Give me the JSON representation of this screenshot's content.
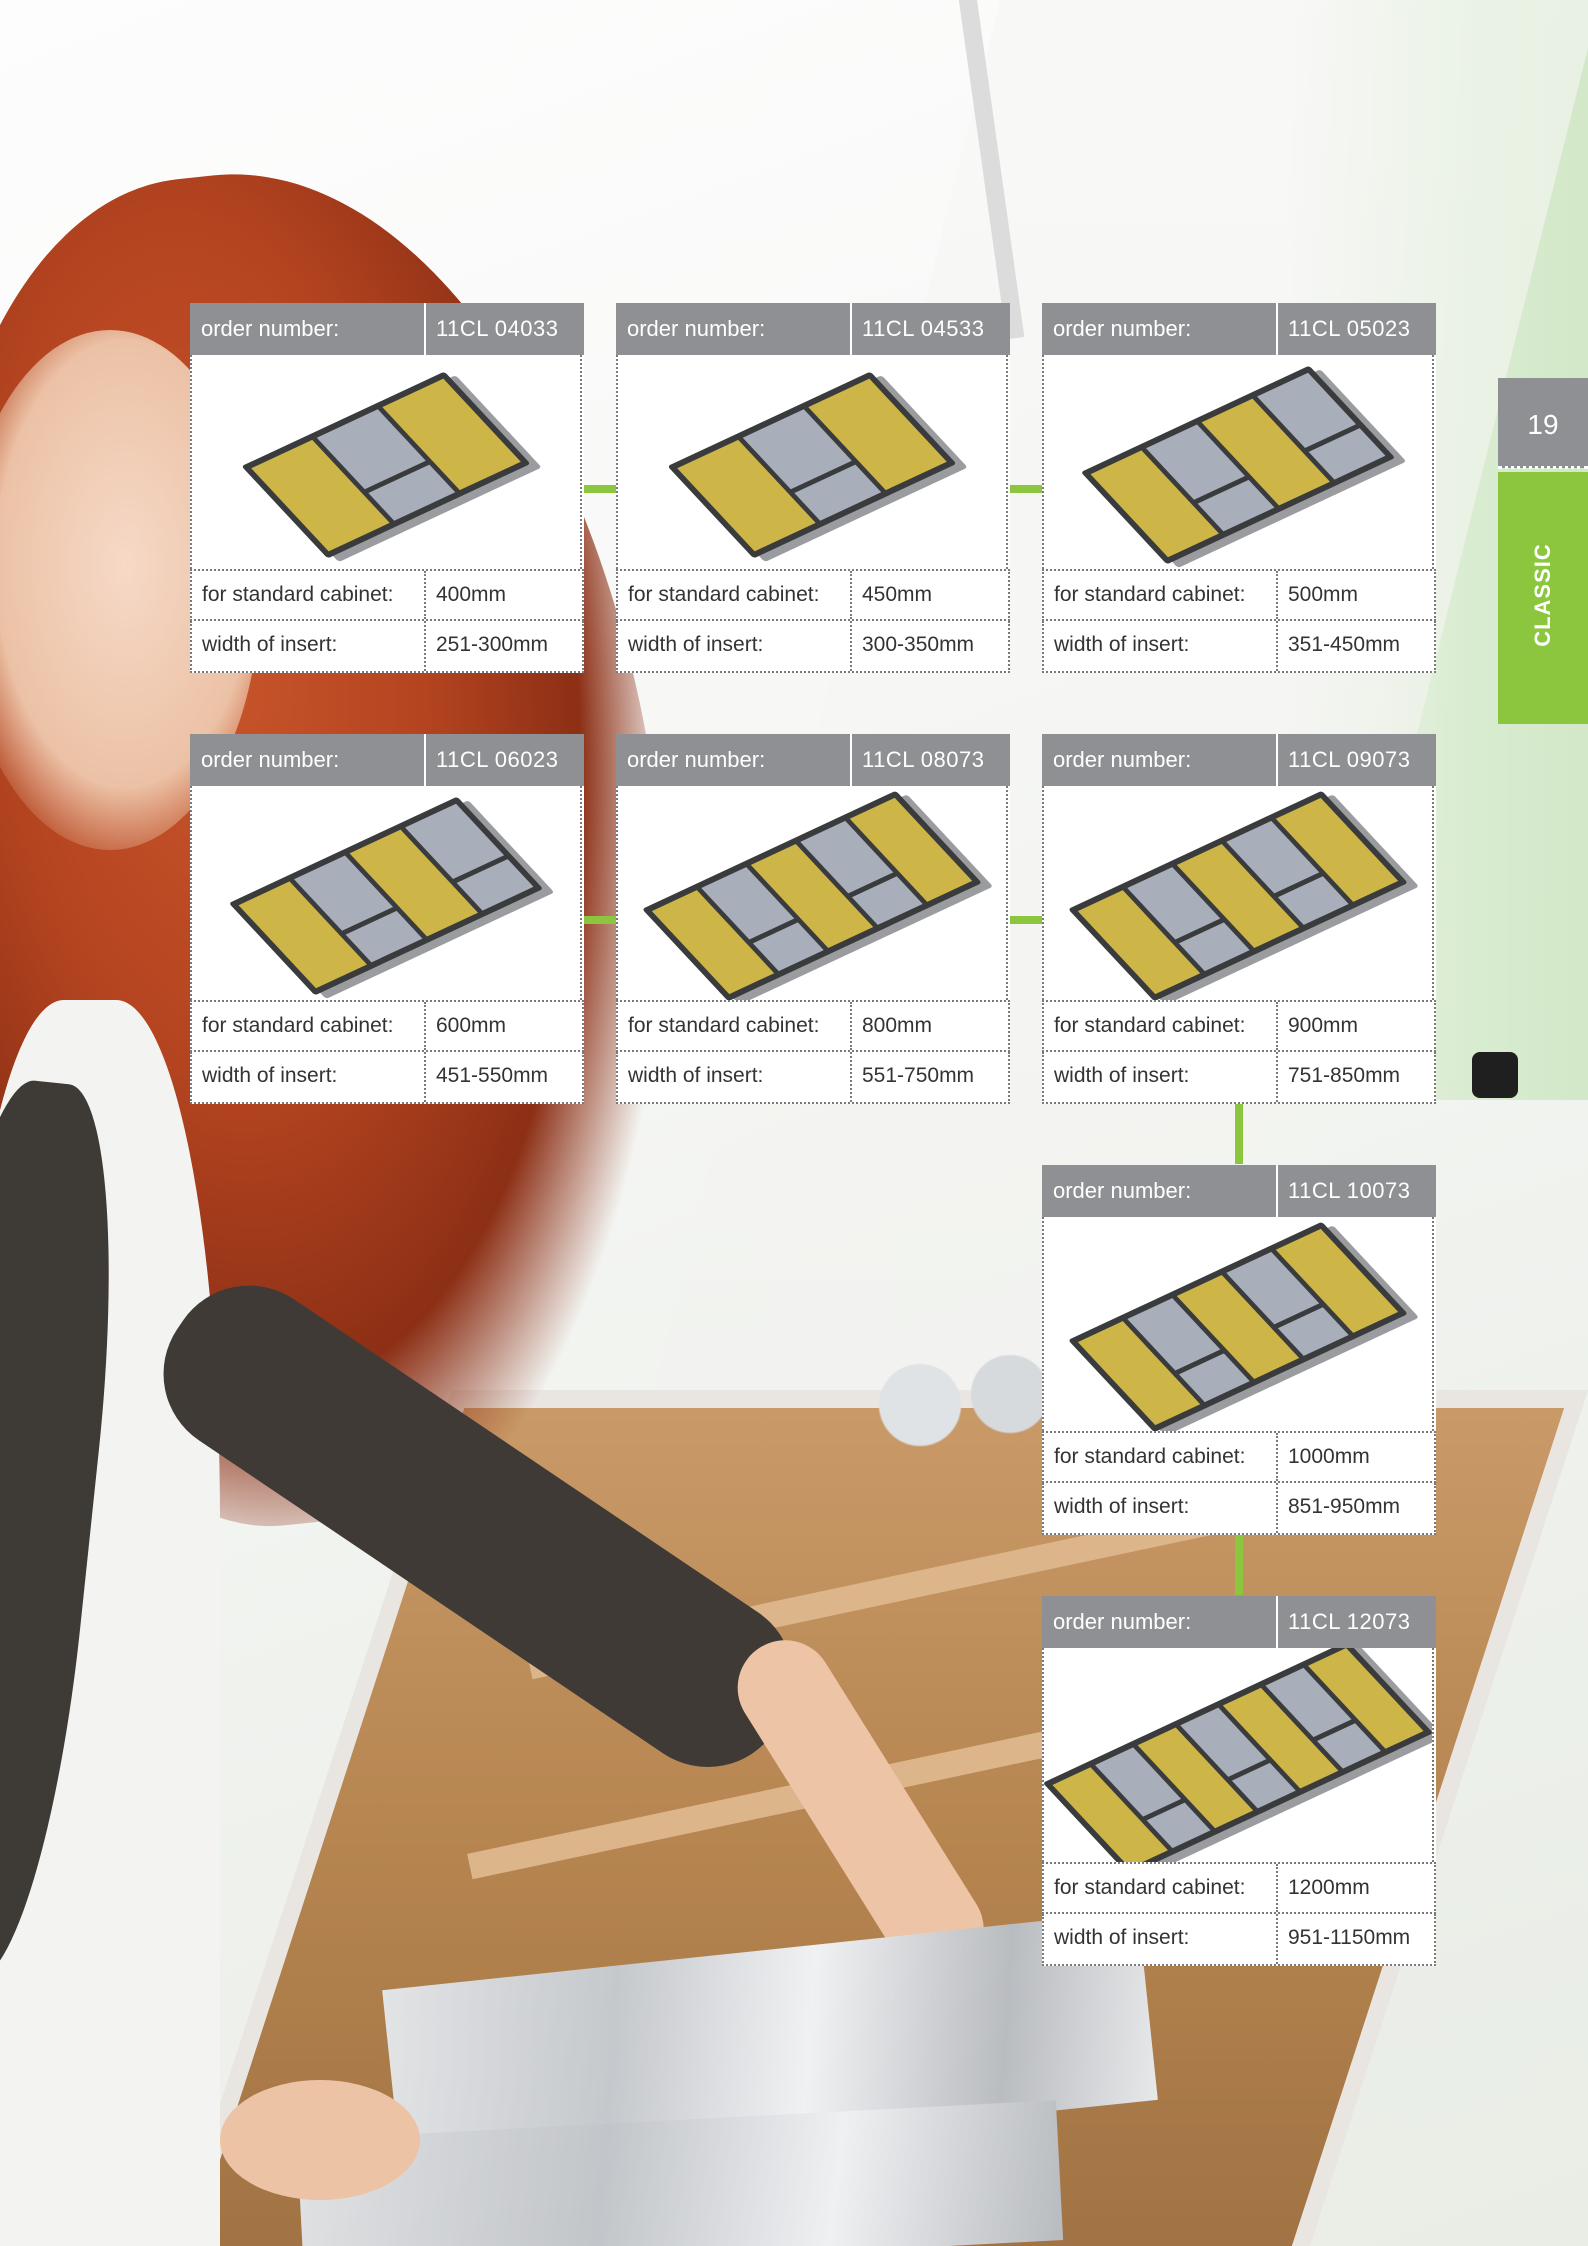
{
  "page_number": "19",
  "section_tab": "CLASSIC",
  "accent_color": "#8cc63f",
  "header_color": "#8f9093",
  "labels": {
    "order_number": "order number:",
    "standard_cabinet": "for standard cabinet:",
    "insert_width": "width of insert:"
  },
  "products": [
    {
      "order_number": "11CL 04033",
      "standard_cabinet": "400mm",
      "insert_width": "251-300mm",
      "compartments": 3
    },
    {
      "order_number": "11CL 04533",
      "standard_cabinet": "450mm",
      "insert_width": "300-350mm",
      "compartments": 3
    },
    {
      "order_number": "11CL 05023",
      "standard_cabinet": "500mm",
      "insert_width": "351-450mm",
      "compartments": 4
    },
    {
      "order_number": "11CL 06023",
      "standard_cabinet": "600mm",
      "insert_width": "451-550mm",
      "compartments": 4
    },
    {
      "order_number": "11CL 08073",
      "standard_cabinet": "800mm",
      "insert_width": "551-750mm",
      "compartments": 5
    },
    {
      "order_number": "11CL 09073",
      "standard_cabinet": "900mm",
      "insert_width": "751-850mm",
      "compartments": 5
    },
    {
      "order_number": "11CL 10073",
      "standard_cabinet": "1000mm",
      "insert_width": "851-950mm",
      "compartments": 5
    },
    {
      "order_number": "11CL 12073",
      "standard_cabinet": "1200mm",
      "insert_width": "951-1150mm",
      "compartments": 7
    }
  ]
}
